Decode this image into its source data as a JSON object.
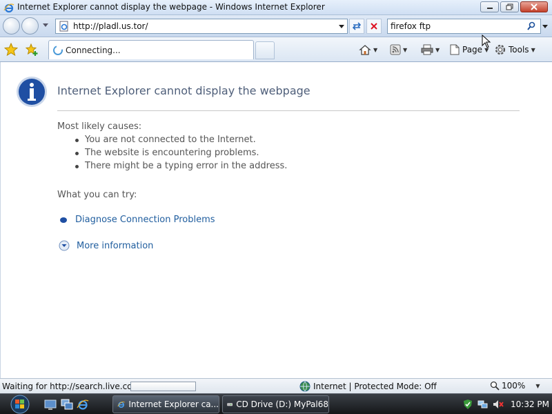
{
  "window": {
    "title": "Internet Explorer cannot display the webpage - Windows Internet Explorer"
  },
  "address_bar": {
    "url": "http://pladl.us.tor/"
  },
  "search": {
    "value": "firefox ftp"
  },
  "tab": {
    "label": "Connecting..."
  },
  "command_bar": {
    "page_label": "Page",
    "tools_label": "Tools"
  },
  "content": {
    "heading": "Internet Explorer cannot display the webpage",
    "causes_title": "Most likely causes:",
    "causes": [
      "You are not connected to the Internet.",
      "The website is encountering problems.",
      "There might be a typing error in the address."
    ],
    "try_title": "What you can try:",
    "diagnose_link": "Diagnose Connection Problems",
    "more_info_link": "More information"
  },
  "status_bar": {
    "text": "Waiting for http://search.live.com/",
    "zone": "Internet | Protected Mode: Off",
    "zoom": "100%"
  },
  "taskbar": {
    "tasks": [
      "Internet Explorer ca...",
      "CD Drive (D:) MyPal68"
    ],
    "clock": "10:32 PM"
  },
  "colors": {
    "heading": "#4e5e79",
    "link": "#1f5d9e",
    "info_icon": "#1f4fa3"
  }
}
